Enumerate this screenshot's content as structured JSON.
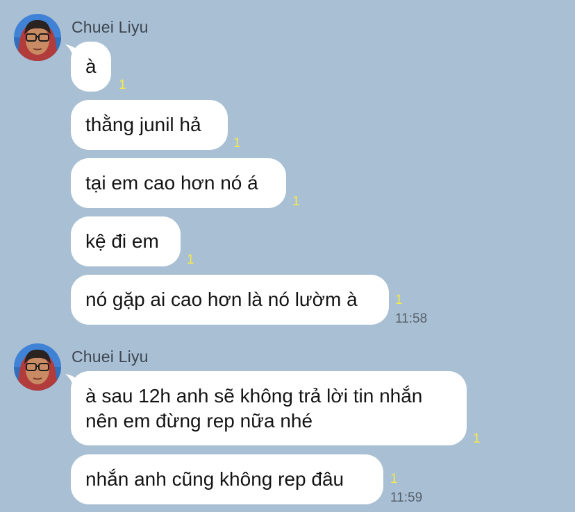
{
  "groups": [
    {
      "sender": "Chuei Liyu",
      "messages": [
        {
          "lines": [
            "à"
          ],
          "read": "1"
        },
        {
          "lines": [
            "thằng junil hả"
          ],
          "read": "1"
        },
        {
          "lines": [
            "tại em cao hơn nó á"
          ],
          "read": "1"
        },
        {
          "lines": [
            "kệ đi em"
          ],
          "read": "1"
        },
        {
          "lines": [
            "nó gặp ai cao hơn là nó lườm à"
          ],
          "read": "1",
          "time": "11:58"
        }
      ]
    },
    {
      "sender": "Chuei Liyu",
      "messages": [
        {
          "lines": [
            "à sau 12h anh sẽ không trả lời tin nhắn",
            "nên em đừng rep nữa nhé"
          ],
          "read": "1"
        },
        {
          "lines": [
            "nhắn anh cũng không rep đâu"
          ],
          "read": "1",
          "time": "11:59"
        }
      ]
    }
  ],
  "colors": {
    "background": "#a9bfd3",
    "bubble": "#ffffff",
    "read_count": "#f4ea4a",
    "time": "#56606c"
  }
}
